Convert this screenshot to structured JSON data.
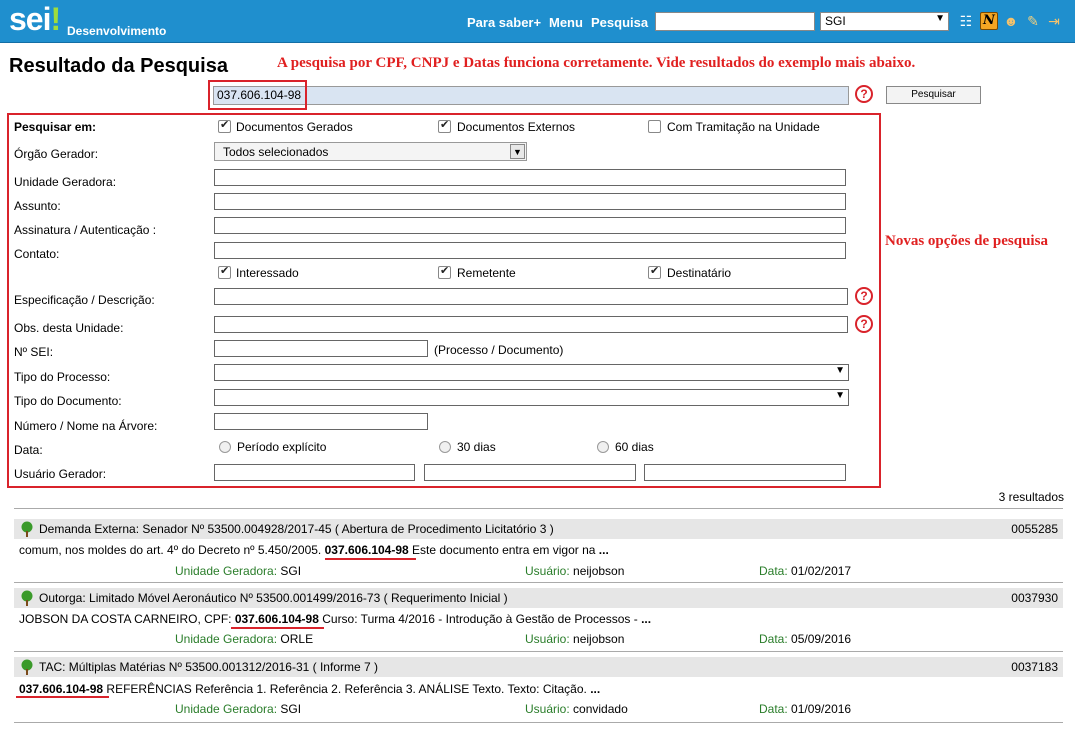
{
  "header": {
    "logo_text": "sei",
    "logo_excl": "!",
    "org": "Desenvolvimento",
    "links": [
      "Para saber+",
      "Menu",
      "Pesquisa"
    ],
    "unit_select": "SGI",
    "icons": [
      "list-icon",
      "n-icon",
      "user-icon",
      "tools-icon",
      "exit-icon"
    ],
    "n_icon_label": "N"
  },
  "title": "Resultado da Pesquisa",
  "annotations": {
    "top": "A pesquisa por CPF, CNPJ e Datas funciona corretamente. Vide resultados do exemplo mais abaixo.",
    "side": "Novas opções de pesquisa"
  },
  "search": {
    "value": "037.606.104-98",
    "button": "Pesquisar",
    "help": "?"
  },
  "form": {
    "pesquisar_em": "Pesquisar em:",
    "doc_gerados": "Documentos Gerados",
    "doc_externos": "Documentos Externos",
    "com_tramitacao": "Com Tramitação na Unidade",
    "orgao_label": "Órgão Gerador:",
    "orgao_value": "Todos selecionados",
    "unidade_label": "Unidade Geradora:",
    "assunto_label": "Assunto:",
    "assinatura_label": "Assinatura / Autenticação :",
    "contato_label": "Contato:",
    "interessado": "Interessado",
    "remetente": "Remetente",
    "destinatario": "Destinatário",
    "especificacao_label": "Especificação / Descrição:",
    "obs_label": "Obs. desta Unidade:",
    "nsei_label": "Nº SEI:",
    "nsei_hint": "(Processo / Documento)",
    "tipo_processo_label": "Tipo do Processo:",
    "tipo_documento_label": "Tipo do Documento:",
    "numero_label": "Número / Nome na Árvore:",
    "data_label": "Data:",
    "periodo": "Período explícito",
    "dias30": "30 dias",
    "dias60": "60 dias",
    "usuario_label": "Usuário Gerador:"
  },
  "results": {
    "count": "3 resultados",
    "meta_labels": {
      "unidade": "Unidade Geradora:",
      "usuario": "Usuário:",
      "data": "Data:"
    },
    "items": [
      {
        "title": "Demanda Externa: Senador Nº 53500.004928/2017-45 ( Abertura de Procedimento Licitatório 3 )",
        "number": "0055285",
        "snip_before": "comum, nos moldes do art. 4º do Decreto nº 5.450/2005. ",
        "snip_hl": "037.606.104-98",
        "snip_after": " Este documento entra em vigor na ",
        "snip_more": "...",
        "unidade": "SGI",
        "usuario": "neijobson",
        "data": "01/02/2017"
      },
      {
        "title": "Outorga: Limitado Móvel Aeronáutico Nº 53500.001499/2016-73 ( Requerimento Inicial )",
        "number": "0037930",
        "snip_before": "JOBSON DA COSTA CARNEIRO, CPF: ",
        "snip_hl": "037.606.104-98",
        "snip_after": " Curso: Turma 4/2016 - Introdução à Gestão de Processos - ",
        "snip_more": "...",
        "unidade": "ORLE",
        "usuario": "neijobson",
        "data": "05/09/2016"
      },
      {
        "title": "TAC: Múltiplas Matérias Nº 53500.001312/2016-31 ( Informe 7 )",
        "number": "0037183",
        "snip_before": "",
        "snip_hl": "037.606.104-98",
        "snip_after": " REFERÊNCIAS Referência 1. Referência 2. Referência 3. ANÁLISE Texto. Texto: Citação. ",
        "snip_more": "...",
        "unidade": "SGI",
        "usuario": "convidado",
        "data": "01/09/2016"
      }
    ]
  },
  "colors": {
    "topbar": "#1f8fce",
    "accent_red": "#d9232b",
    "meta_green": "#2a7d2a"
  }
}
